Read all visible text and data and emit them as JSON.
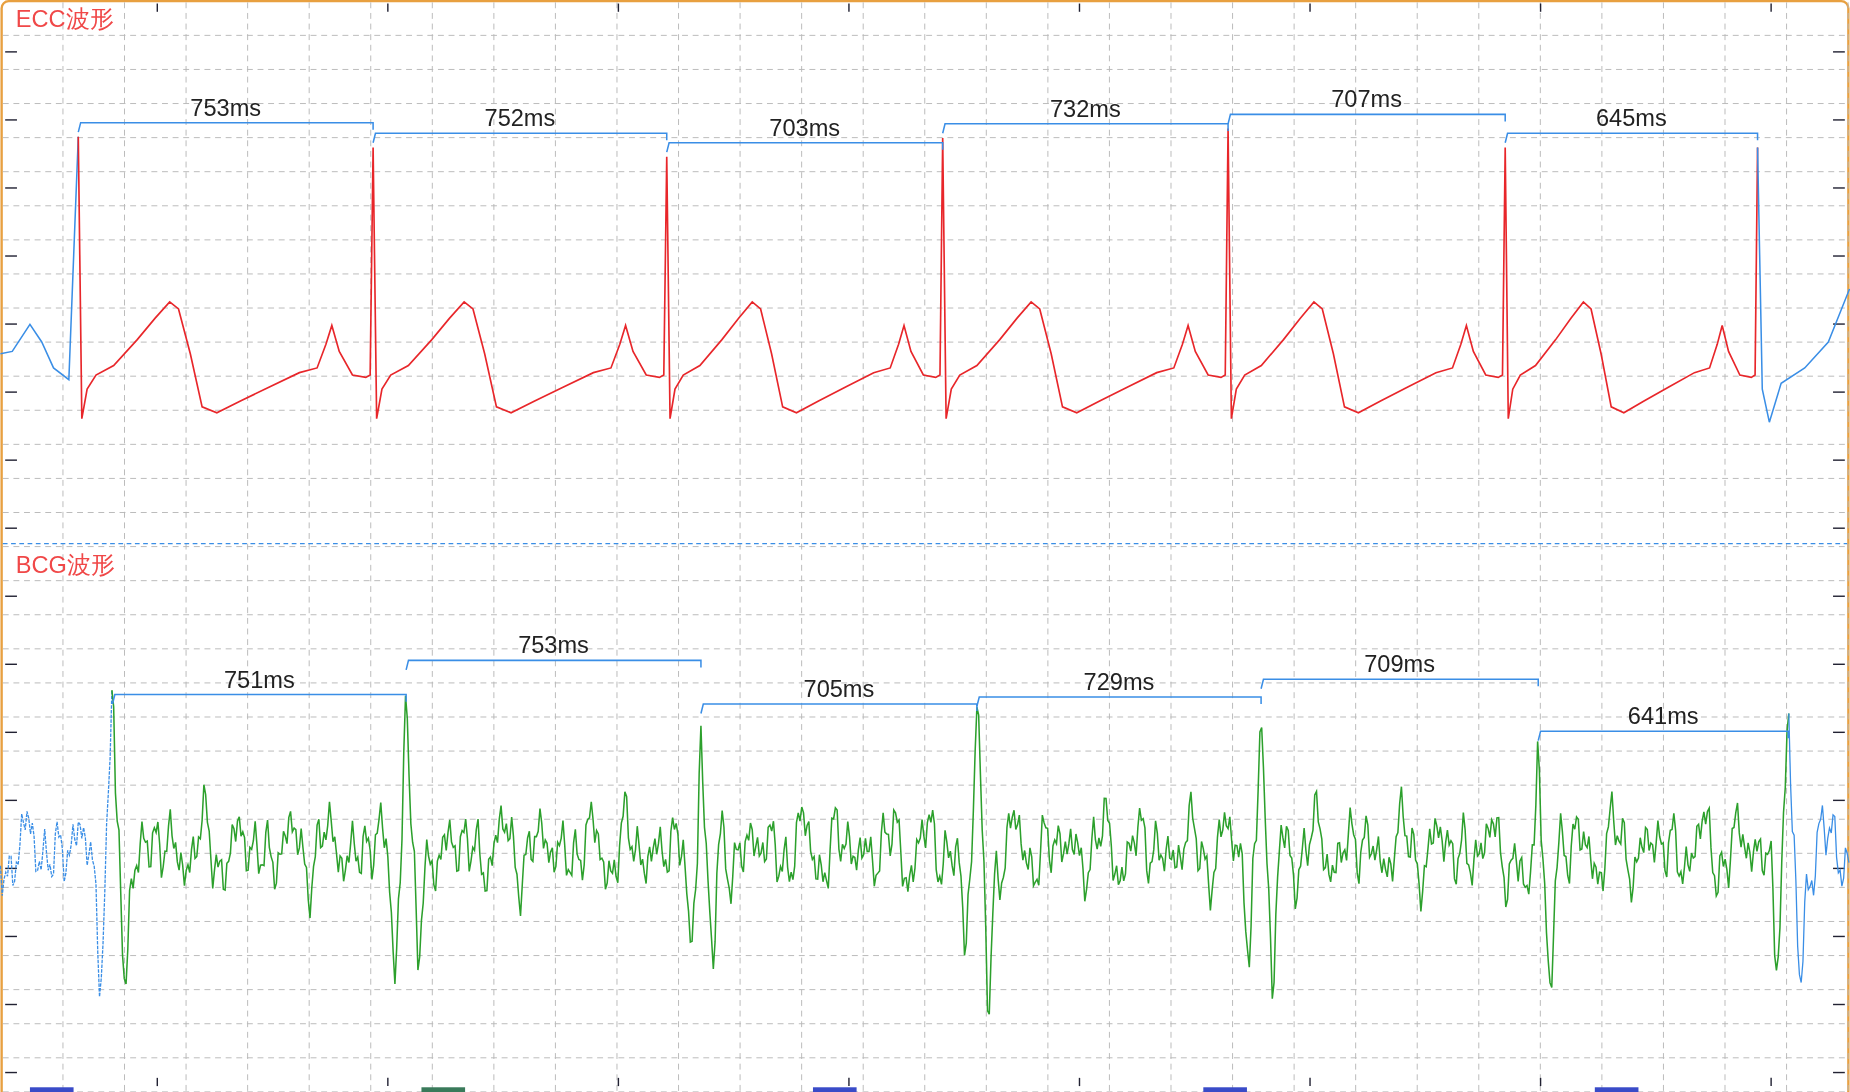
{
  "panels": [
    {
      "title": "ECC波形",
      "color": "#e8262a",
      "intervals": [
        "753ms",
        "752ms",
        "703ms",
        "732ms",
        "707ms",
        "645ms"
      ]
    },
    {
      "title": "BCG波形",
      "color": "#2ca02c",
      "intervals": [
        "751ms",
        "753ms",
        "705ms",
        "729ms",
        "709ms",
        "641ms"
      ]
    }
  ]
}
